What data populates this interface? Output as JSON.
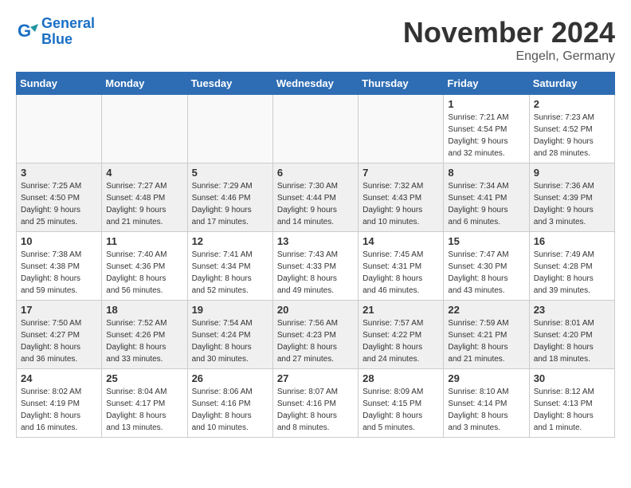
{
  "logo": {
    "line1": "General",
    "line2": "Blue"
  },
  "title": "November 2024",
  "location": "Engeln, Germany",
  "weekdays": [
    "Sunday",
    "Monday",
    "Tuesday",
    "Wednesday",
    "Thursday",
    "Friday",
    "Saturday"
  ],
  "weeks": [
    [
      {
        "day": "",
        "info": ""
      },
      {
        "day": "",
        "info": ""
      },
      {
        "day": "",
        "info": ""
      },
      {
        "day": "",
        "info": ""
      },
      {
        "day": "",
        "info": ""
      },
      {
        "day": "1",
        "info": "Sunrise: 7:21 AM\nSunset: 4:54 PM\nDaylight: 9 hours\nand 32 minutes."
      },
      {
        "day": "2",
        "info": "Sunrise: 7:23 AM\nSunset: 4:52 PM\nDaylight: 9 hours\nand 28 minutes."
      }
    ],
    [
      {
        "day": "3",
        "info": "Sunrise: 7:25 AM\nSunset: 4:50 PM\nDaylight: 9 hours\nand 25 minutes."
      },
      {
        "day": "4",
        "info": "Sunrise: 7:27 AM\nSunset: 4:48 PM\nDaylight: 9 hours\nand 21 minutes."
      },
      {
        "day": "5",
        "info": "Sunrise: 7:29 AM\nSunset: 4:46 PM\nDaylight: 9 hours\nand 17 minutes."
      },
      {
        "day": "6",
        "info": "Sunrise: 7:30 AM\nSunset: 4:44 PM\nDaylight: 9 hours\nand 14 minutes."
      },
      {
        "day": "7",
        "info": "Sunrise: 7:32 AM\nSunset: 4:43 PM\nDaylight: 9 hours\nand 10 minutes."
      },
      {
        "day": "8",
        "info": "Sunrise: 7:34 AM\nSunset: 4:41 PM\nDaylight: 9 hours\nand 6 minutes."
      },
      {
        "day": "9",
        "info": "Sunrise: 7:36 AM\nSunset: 4:39 PM\nDaylight: 9 hours\nand 3 minutes."
      }
    ],
    [
      {
        "day": "10",
        "info": "Sunrise: 7:38 AM\nSunset: 4:38 PM\nDaylight: 8 hours\nand 59 minutes."
      },
      {
        "day": "11",
        "info": "Sunrise: 7:40 AM\nSunset: 4:36 PM\nDaylight: 8 hours\nand 56 minutes."
      },
      {
        "day": "12",
        "info": "Sunrise: 7:41 AM\nSunset: 4:34 PM\nDaylight: 8 hours\nand 52 minutes."
      },
      {
        "day": "13",
        "info": "Sunrise: 7:43 AM\nSunset: 4:33 PM\nDaylight: 8 hours\nand 49 minutes."
      },
      {
        "day": "14",
        "info": "Sunrise: 7:45 AM\nSunset: 4:31 PM\nDaylight: 8 hours\nand 46 minutes."
      },
      {
        "day": "15",
        "info": "Sunrise: 7:47 AM\nSunset: 4:30 PM\nDaylight: 8 hours\nand 43 minutes."
      },
      {
        "day": "16",
        "info": "Sunrise: 7:49 AM\nSunset: 4:28 PM\nDaylight: 8 hours\nand 39 minutes."
      }
    ],
    [
      {
        "day": "17",
        "info": "Sunrise: 7:50 AM\nSunset: 4:27 PM\nDaylight: 8 hours\nand 36 minutes."
      },
      {
        "day": "18",
        "info": "Sunrise: 7:52 AM\nSunset: 4:26 PM\nDaylight: 8 hours\nand 33 minutes."
      },
      {
        "day": "19",
        "info": "Sunrise: 7:54 AM\nSunset: 4:24 PM\nDaylight: 8 hours\nand 30 minutes."
      },
      {
        "day": "20",
        "info": "Sunrise: 7:56 AM\nSunset: 4:23 PM\nDaylight: 8 hours\nand 27 minutes."
      },
      {
        "day": "21",
        "info": "Sunrise: 7:57 AM\nSunset: 4:22 PM\nDaylight: 8 hours\nand 24 minutes."
      },
      {
        "day": "22",
        "info": "Sunrise: 7:59 AM\nSunset: 4:21 PM\nDaylight: 8 hours\nand 21 minutes."
      },
      {
        "day": "23",
        "info": "Sunrise: 8:01 AM\nSunset: 4:20 PM\nDaylight: 8 hours\nand 18 minutes."
      }
    ],
    [
      {
        "day": "24",
        "info": "Sunrise: 8:02 AM\nSunset: 4:19 PM\nDaylight: 8 hours\nand 16 minutes."
      },
      {
        "day": "25",
        "info": "Sunrise: 8:04 AM\nSunset: 4:17 PM\nDaylight: 8 hours\nand 13 minutes."
      },
      {
        "day": "26",
        "info": "Sunrise: 8:06 AM\nSunset: 4:16 PM\nDaylight: 8 hours\nand 10 minutes."
      },
      {
        "day": "27",
        "info": "Sunrise: 8:07 AM\nSunset: 4:16 PM\nDaylight: 8 hours\nand 8 minutes."
      },
      {
        "day": "28",
        "info": "Sunrise: 8:09 AM\nSunset: 4:15 PM\nDaylight: 8 hours\nand 5 minutes."
      },
      {
        "day": "29",
        "info": "Sunrise: 8:10 AM\nSunset: 4:14 PM\nDaylight: 8 hours\nand 3 minutes."
      },
      {
        "day": "30",
        "info": "Sunrise: 8:12 AM\nSunset: 4:13 PM\nDaylight: 8 hours\nand 1 minute."
      }
    ]
  ]
}
